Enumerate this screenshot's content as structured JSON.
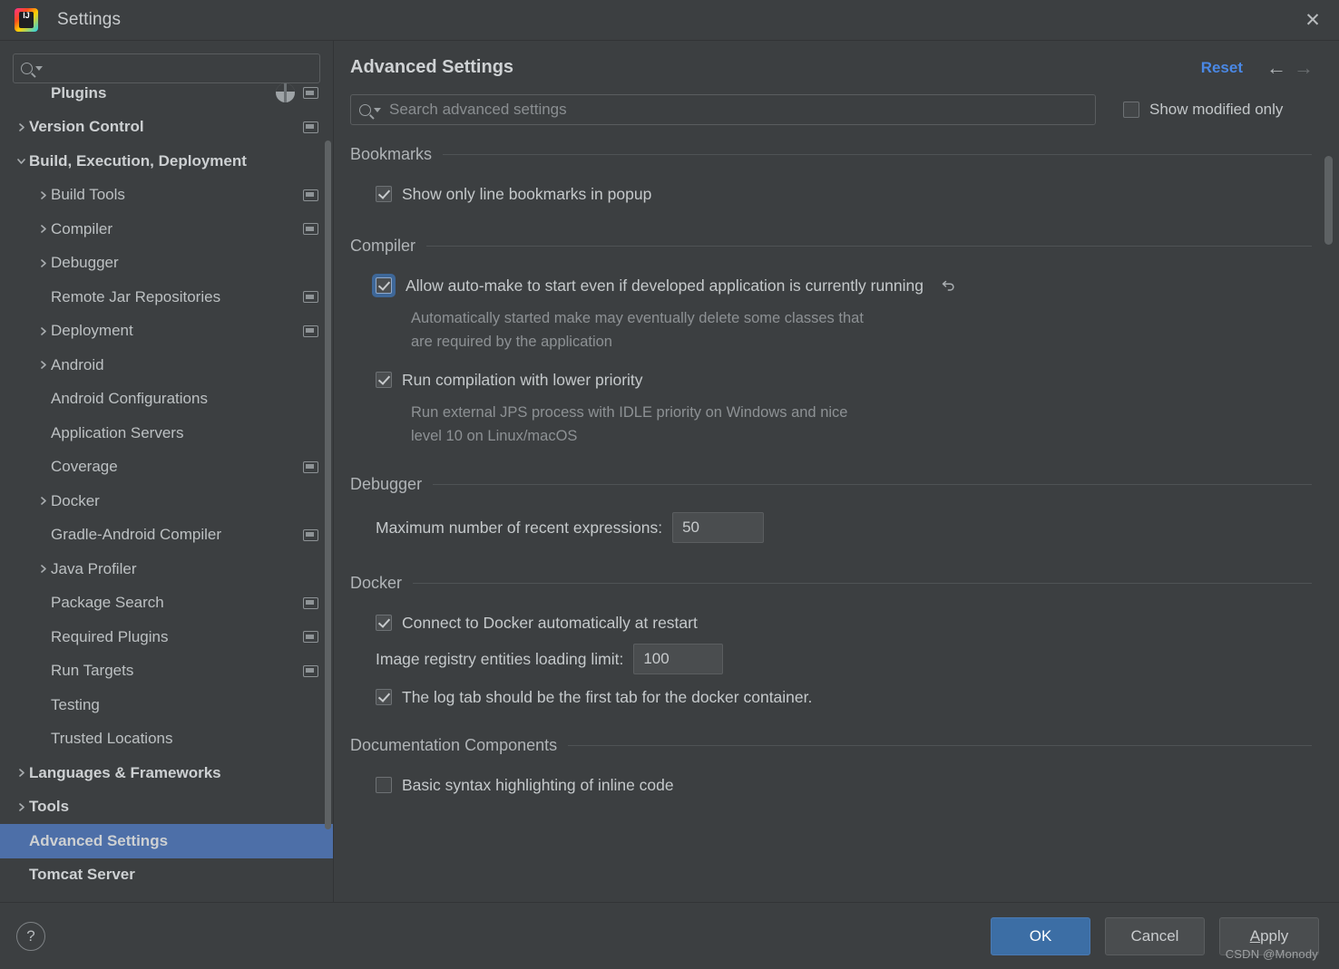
{
  "window": {
    "title": "Settings",
    "logo_text": "IJ",
    "close_icon": "✕"
  },
  "sidebar": {
    "search_placeholder": "",
    "items": [
      {
        "label": "Plugins",
        "indent": 1,
        "chevron": "none",
        "bold": true,
        "badge": "project",
        "plugin_badge": true,
        "selected": false
      },
      {
        "label": "Version Control",
        "indent": 0,
        "chevron": "collapsed",
        "bold": true,
        "badge": "project",
        "plugin_badge": false,
        "selected": false
      },
      {
        "label": "Build, Execution, Deployment",
        "indent": 0,
        "chevron": "expanded",
        "bold": true,
        "badge": "none",
        "plugin_badge": false,
        "selected": false
      },
      {
        "label": "Build Tools",
        "indent": 1,
        "chevron": "collapsed",
        "bold": false,
        "badge": "project",
        "plugin_badge": false,
        "selected": false
      },
      {
        "label": "Compiler",
        "indent": 1,
        "chevron": "collapsed",
        "bold": false,
        "badge": "project",
        "plugin_badge": false,
        "selected": false
      },
      {
        "label": "Debugger",
        "indent": 1,
        "chevron": "collapsed",
        "bold": false,
        "badge": "none",
        "plugin_badge": false,
        "selected": false
      },
      {
        "label": "Remote Jar Repositories",
        "indent": 1,
        "chevron": "none",
        "bold": false,
        "badge": "project",
        "plugin_badge": false,
        "selected": false
      },
      {
        "label": "Deployment",
        "indent": 1,
        "chevron": "collapsed",
        "bold": false,
        "badge": "project",
        "plugin_badge": false,
        "selected": false
      },
      {
        "label": "Android",
        "indent": 1,
        "chevron": "collapsed",
        "bold": false,
        "badge": "none",
        "plugin_badge": false,
        "selected": false
      },
      {
        "label": "Android Configurations",
        "indent": 1,
        "chevron": "none",
        "bold": false,
        "badge": "none",
        "plugin_badge": false,
        "selected": false
      },
      {
        "label": "Application Servers",
        "indent": 1,
        "chevron": "none",
        "bold": false,
        "badge": "none",
        "plugin_badge": false,
        "selected": false
      },
      {
        "label": "Coverage",
        "indent": 1,
        "chevron": "none",
        "bold": false,
        "badge": "project",
        "plugin_badge": false,
        "selected": false
      },
      {
        "label": "Docker",
        "indent": 1,
        "chevron": "collapsed",
        "bold": false,
        "badge": "none",
        "plugin_badge": false,
        "selected": false
      },
      {
        "label": "Gradle-Android Compiler",
        "indent": 1,
        "chevron": "none",
        "bold": false,
        "badge": "project",
        "plugin_badge": false,
        "selected": false
      },
      {
        "label": "Java Profiler",
        "indent": 1,
        "chevron": "collapsed",
        "bold": false,
        "badge": "none",
        "plugin_badge": false,
        "selected": false
      },
      {
        "label": "Package Search",
        "indent": 1,
        "chevron": "none",
        "bold": false,
        "badge": "project",
        "plugin_badge": false,
        "selected": false
      },
      {
        "label": "Required Plugins",
        "indent": 1,
        "chevron": "none",
        "bold": false,
        "badge": "project",
        "plugin_badge": false,
        "selected": false
      },
      {
        "label": "Run Targets",
        "indent": 1,
        "chevron": "none",
        "bold": false,
        "badge": "project",
        "plugin_badge": false,
        "selected": false
      },
      {
        "label": "Testing",
        "indent": 1,
        "chevron": "none",
        "bold": false,
        "badge": "none",
        "plugin_badge": false,
        "selected": false
      },
      {
        "label": "Trusted Locations",
        "indent": 1,
        "chevron": "none",
        "bold": false,
        "badge": "none",
        "plugin_badge": false,
        "selected": false
      },
      {
        "label": "Languages & Frameworks",
        "indent": 0,
        "chevron": "collapsed",
        "bold": true,
        "badge": "none",
        "plugin_badge": false,
        "selected": false
      },
      {
        "label": "Tools",
        "indent": 0,
        "chevron": "collapsed",
        "bold": true,
        "badge": "none",
        "plugin_badge": false,
        "selected": false
      },
      {
        "label": "Advanced Settings",
        "indent": 0,
        "chevron": "none",
        "bold": true,
        "badge": "none",
        "plugin_badge": false,
        "selected": true
      },
      {
        "label": "Tomcat Server",
        "indent": 0,
        "chevron": "none",
        "bold": true,
        "badge": "none",
        "plugin_badge": false,
        "selected": false
      }
    ]
  },
  "main": {
    "page_title": "Advanced Settings",
    "reset_label": "Reset",
    "back_icon": "←",
    "forward_icon": "→",
    "search_placeholder": "Search advanced settings",
    "show_modified_label": "Show modified only",
    "show_modified_checked": false,
    "groups": [
      {
        "title": "Bookmarks",
        "rows": [
          {
            "kind": "checkbox",
            "label": "Show only line bookmarks in popup",
            "checked": true,
            "focused": false,
            "revert": false,
            "desc": ""
          }
        ]
      },
      {
        "title": "Compiler",
        "rows": [
          {
            "kind": "checkbox",
            "label": "Allow auto-make to start even if developed application is currently running",
            "checked": true,
            "focused": true,
            "revert": true,
            "desc": "Automatically started make may eventually delete some classes that\nare required by the application"
          },
          {
            "kind": "checkbox",
            "label": "Run compilation with lower priority",
            "checked": true,
            "focused": false,
            "revert": false,
            "desc": "Run external JPS process with IDLE priority on Windows and nice\nlevel 10 on Linux/macOS"
          }
        ]
      },
      {
        "title": "Debugger",
        "rows": [
          {
            "kind": "field",
            "label": "Maximum number of recent expressions:",
            "value": "50",
            "width": "w1"
          }
        ]
      },
      {
        "title": "Docker",
        "rows": [
          {
            "kind": "checkbox",
            "label": "Connect to Docker automatically at restart",
            "checked": true,
            "focused": false,
            "revert": false,
            "desc": ""
          },
          {
            "kind": "field",
            "label": "Image registry entities loading limit:",
            "value": "100",
            "width": "w2"
          },
          {
            "kind": "checkbox",
            "label": "The log tab should be the first tab for the docker container.",
            "checked": true,
            "focused": false,
            "revert": false,
            "desc": ""
          }
        ]
      },
      {
        "title": "Documentation Components",
        "rows": [
          {
            "kind": "checkbox",
            "label": "Basic syntax highlighting of inline code",
            "checked": false,
            "focused": false,
            "revert": false,
            "desc": ""
          }
        ]
      }
    ]
  },
  "footer": {
    "help_icon": "?",
    "ok_label": "OK",
    "cancel_label": "Cancel",
    "apply_label": "Apply",
    "apply_mnemonic": "A",
    "watermark": "CSDN @Monody"
  },
  "colors": {
    "accent_selection": "#4d6fa8",
    "link": "#4a88e5",
    "primary_button": "#3c6ea5",
    "panel_bg": "#3c3f41"
  }
}
